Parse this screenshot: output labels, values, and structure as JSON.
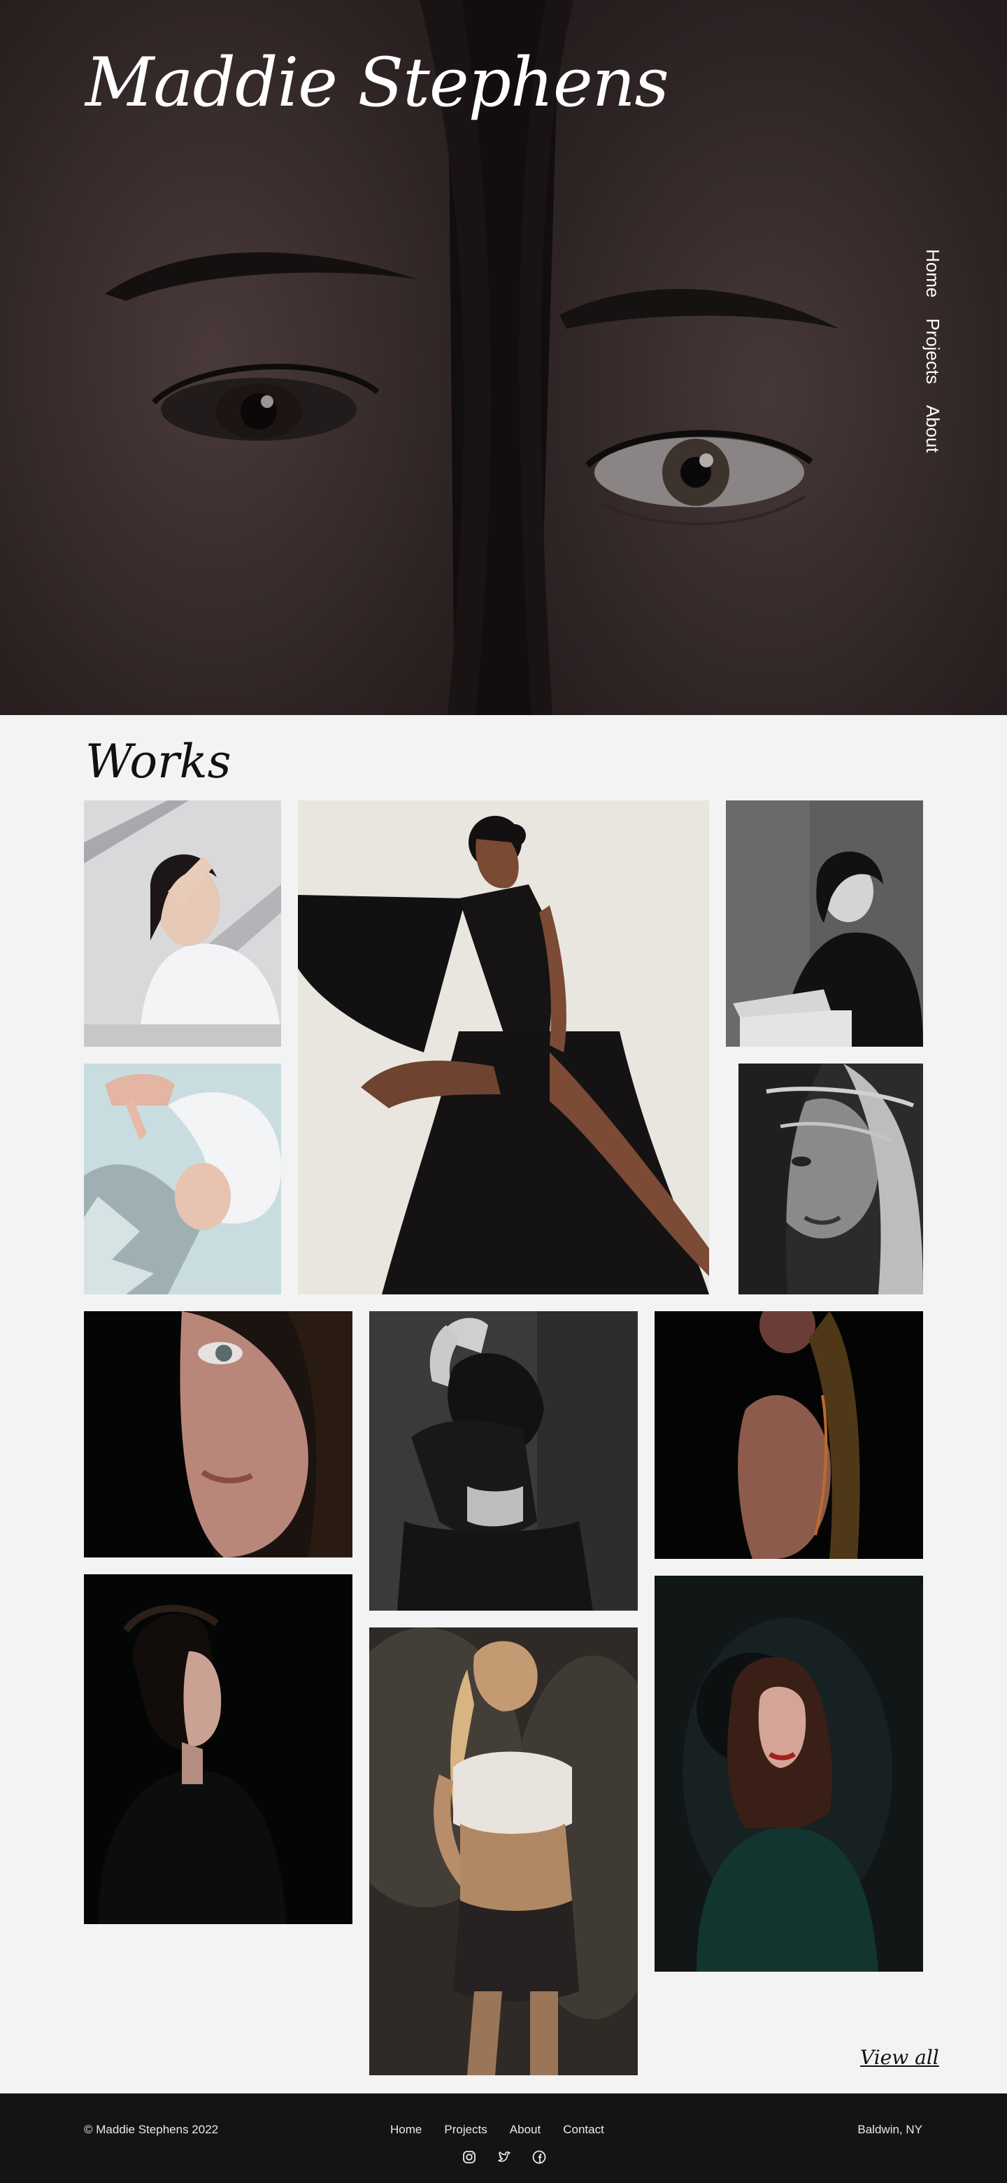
{
  "brand": {
    "name": "Maddie Stephens"
  },
  "nav": {
    "home": "Home",
    "projects": "Projects",
    "about": "About"
  },
  "works": {
    "title": "Works",
    "view_all": "View all"
  },
  "photos": [
    {
      "name": "photo-woman-white-shirt",
      "desc_icon": "image"
    },
    {
      "name": "photo-woman-black-dress",
      "desc_icon": "image"
    },
    {
      "name": "photo-woman-bw-seated",
      "desc_icon": "image"
    },
    {
      "name": "photo-woman-fur-foil",
      "desc_icon": "image"
    },
    {
      "name": "photo-woman-bw-hair",
      "desc_icon": "image"
    },
    {
      "name": "photo-woman-face-shadow",
      "desc_icon": "image"
    },
    {
      "name": "photo-woman-dancing-bw",
      "desc_icon": "image"
    },
    {
      "name": "photo-woman-bare-shoulder",
      "desc_icon": "image"
    },
    {
      "name": "photo-woman-profile-dark",
      "desc_icon": "image"
    },
    {
      "name": "photo-woman-smoke-blonde",
      "desc_icon": "image"
    },
    {
      "name": "photo-woman-red-hair-green",
      "desc_icon": "image"
    }
  ],
  "footer": {
    "copyright": "© Maddie  Stephens 2022",
    "links": {
      "home": "Home",
      "projects": "Projects",
      "about": "About",
      "contact": "Contact"
    },
    "location": "Baldwin, NY",
    "social_icons": [
      "instagram-icon",
      "twitter-icon",
      "facebook-icon"
    ]
  },
  "colors": {
    "background": "#f3f3f3",
    "footer": "#141414",
    "text": "#111111"
  }
}
